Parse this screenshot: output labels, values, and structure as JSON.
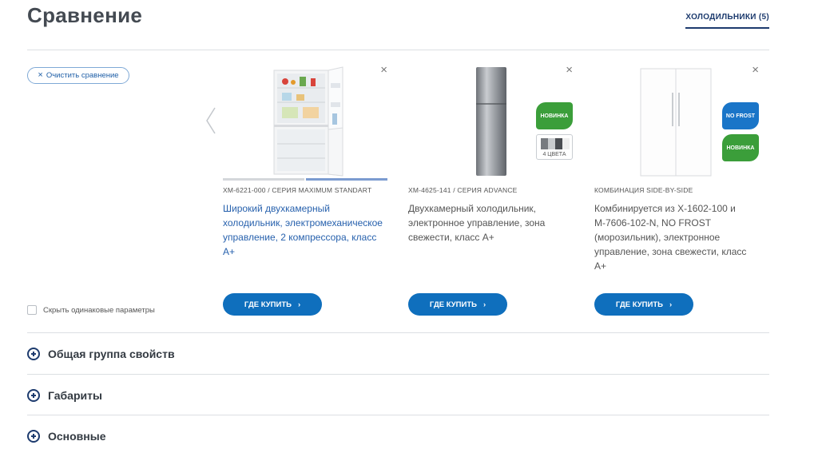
{
  "page": {
    "title": "Сравнение",
    "category_tab": "холодильники (5)",
    "clear_label": "Очистить сравнение",
    "hide_same_label": "Скрыть одинаковые параметры"
  },
  "products": [
    {
      "sku": "ХМ-6221-000 / СЕРИЯ MAXIMUM STANDART",
      "description": "Широкий двухкамерный холодильник, электромеханическое управление, 2 компрессора, класс А+",
      "buy_label": "ГДЕ КУПИТЬ",
      "remove_icon": "×"
    },
    {
      "sku": "ХМ-4625-141 / СЕРИЯ ADVANCE",
      "description": "Двухкамерный холодильник, электронное управление, зона свежести, класс А+",
      "buy_label": "ГДЕ КУПИТЬ",
      "remove_icon": "×",
      "badges": {
        "new": "НОВИНКА",
        "colors": "4 ЦВЕТА"
      }
    },
    {
      "sku": "КОМБИНАЦИЯ SIDE-BY-SIDE",
      "description": "Комбинируется из Х-1602-100 и М-7606-102-N, NO FROST (морозильник), электронное управление, зона свежести, класс А+",
      "buy_label": "ГДЕ КУПИТЬ",
      "remove_icon": "×",
      "badges": {
        "nofrost": "NO FROST",
        "new": "НОВИНКА"
      }
    }
  ],
  "groups": [
    {
      "label": "Общая группа свойств"
    },
    {
      "label": "Габариты"
    },
    {
      "label": "Основные"
    }
  ],
  "icons": {
    "clear": "close-icon",
    "prev": "chevron-left-icon",
    "buy_arrow": "chevron-right-icon",
    "group": "plus-circle-icon"
  },
  "colors": {
    "primary": "#0f6fbd",
    "dark_blue": "#1d3b6e",
    "link": "#2761ad",
    "badge_green": "#3b9e3a",
    "badge_blue": "#1a75c8"
  }
}
